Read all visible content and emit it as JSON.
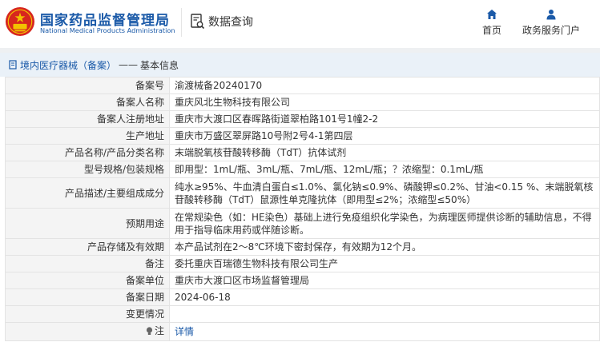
{
  "header": {
    "brand_cn": "国家药品监督管理局",
    "brand_en": "National Medical Products Administration",
    "db_query_label": "数据查询",
    "nav": [
      {
        "label": "首页",
        "icon": "home-icon"
      },
      {
        "label": "政务服务门户",
        "icon": "user-icon"
      }
    ],
    "colors": {
      "brand": "#1b5aa8",
      "logo_red": "#d7261e",
      "logo_gold": "#f2c200"
    }
  },
  "breadcrumb": {
    "section": "境内医疗器械（备案）",
    "separator": "——",
    "current": "基本信息"
  },
  "record": {
    "rows": [
      {
        "key": "备案号",
        "value": "渝渡械备20240170"
      },
      {
        "key": "备案人名称",
        "value": "重庆风北生物科技有限公司"
      },
      {
        "key": "备案人注册地址",
        "value": "重庆市大渡口区春晖路街道翠柏路101号1幢2-2"
      },
      {
        "key": "生产地址",
        "value": "重庆市万盛区翠屏路10号附2号4-1第四层"
      },
      {
        "key": "产品名称/产品分类名称",
        "value": "末端脱氧核苷酸转移酶（TdT）抗体试剂"
      },
      {
        "key": "型号规格/包装规格",
        "value": "即用型：1mL/瓶、3mL/瓶、7mL/瓶、12mL/瓶；？浓缩型：0.1mL/瓶"
      },
      {
        "key": "产品描述/主要组成成分",
        "value": "纯水≥95%、牛血清白蛋白≤1.0%、氯化钠≤0.9%、磷酸钾≤0.2%、甘油<0.15 %、末端脱氧核苷酸转移酶（TdT）鼠源性单克隆抗体（即用型≤2%；浓缩型≤50%）"
      },
      {
        "key": "预期用途",
        "value": "在常规染色（如：HE染色）基础上进行免疫组织化学染色，为病理医师提供诊断的辅助信息，不得用于指导临床用药或伴随诊断。"
      },
      {
        "key": "产品存储及有效期",
        "value": "本产品试剂在2～8℃环境下密封保存，有效期为12个月。"
      },
      {
        "key": "备注",
        "value": "委托重庆百瑞德生物科技有限公司生产"
      },
      {
        "key": "备案单位",
        "value": "重庆市大渡口区市场监督管理局"
      },
      {
        "key": "备案日期",
        "value": "2024-06-18"
      },
      {
        "key": "变更情况",
        "value": ""
      }
    ],
    "note_row": {
      "key": "注",
      "link_label": "详情",
      "icon": "bulb-icon"
    }
  }
}
